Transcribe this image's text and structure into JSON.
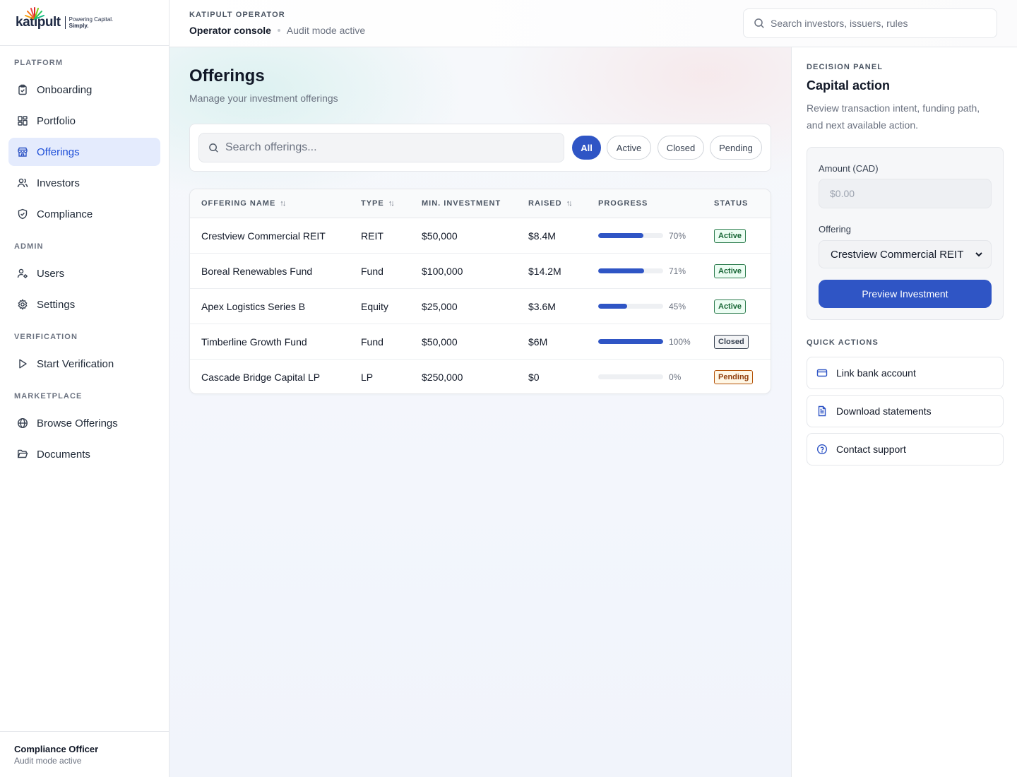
{
  "brand": {
    "logo_text": "katipult",
    "tagline_1": "Powering Capital.",
    "tagline_2": "Simply."
  },
  "sidebar": {
    "sections": [
      {
        "title": "PLATFORM",
        "items": [
          {
            "label": "Onboarding",
            "icon": "clipboard-check-icon"
          },
          {
            "label": "Portfolio",
            "icon": "layout-grid-icon"
          },
          {
            "label": "Offerings",
            "icon": "store-icon",
            "active": true
          },
          {
            "label": "Investors",
            "icon": "users-icon"
          },
          {
            "label": "Compliance",
            "icon": "shield-check-icon"
          }
        ]
      },
      {
        "title": "ADMIN",
        "items": [
          {
            "label": "Users",
            "icon": "user-cog-icon"
          },
          {
            "label": "Settings",
            "icon": "gear-icon"
          }
        ]
      },
      {
        "title": "VERIFICATION",
        "items": [
          {
            "label": "Start Verification",
            "icon": "play-icon"
          }
        ]
      },
      {
        "title": "MARKETPLACE",
        "items": [
          {
            "label": "Browse Offerings",
            "icon": "globe-icon"
          },
          {
            "label": "Documents",
            "icon": "folder-open-icon"
          }
        ]
      }
    ],
    "user": {
      "name": "Compliance Officer",
      "status": "Audit mode active"
    }
  },
  "topbar": {
    "kicker": "KATIPULT OPERATOR",
    "title": "Operator console",
    "subtitle": "Audit mode active",
    "search_placeholder": "Search investors, issuers, rules"
  },
  "main": {
    "title": "Offerings",
    "subtitle": "Manage your investment offerings",
    "search_placeholder": "Search offerings...",
    "filters": [
      "All",
      "Active",
      "Closed",
      "Pending"
    ],
    "active_filter": "All",
    "columns": [
      "OFFERING NAME",
      "TYPE",
      "MIN. INVESTMENT",
      "RAISED",
      "PROGRESS",
      "STATUS"
    ],
    "rows": [
      {
        "name": "Crestview Commercial REIT",
        "type": "REIT",
        "min": "$50,000",
        "raised": "$8.4M",
        "progress": 70,
        "progress_label": "70%",
        "status": "Active"
      },
      {
        "name": "Boreal Renewables Fund",
        "type": "Fund",
        "min": "$100,000",
        "raised": "$14.2M",
        "progress": 71,
        "progress_label": "71%",
        "status": "Active"
      },
      {
        "name": "Apex Logistics Series B",
        "type": "Equity",
        "min": "$25,000",
        "raised": "$3.6M",
        "progress": 45,
        "progress_label": "45%",
        "status": "Active"
      },
      {
        "name": "Timberline Growth Fund",
        "type": "Fund",
        "min": "$50,000",
        "raised": "$6M",
        "progress": 100,
        "progress_label": "100%",
        "status": "Closed"
      },
      {
        "name": "Cascade Bridge Capital LP",
        "type": "LP",
        "min": "$250,000",
        "raised": "$0",
        "progress": 0,
        "progress_label": "0%",
        "status": "Pending"
      }
    ]
  },
  "panel": {
    "kicker": "DECISION PANEL",
    "title": "Capital action",
    "description": "Review transaction intent, funding path, and next available action.",
    "amount_label": "Amount (CAD)",
    "amount_placeholder": "$0.00",
    "offering_label": "Offering",
    "offering_selected": "Crestview Commercial REIT",
    "preview_button": "Preview Investment",
    "quick_actions_title": "QUICK ACTIONS",
    "quick_actions": [
      {
        "label": "Link bank account",
        "icon": "credit-card-icon"
      },
      {
        "label": "Download statements",
        "icon": "file-text-icon"
      },
      {
        "label": "Contact support",
        "icon": "help-circle-icon"
      }
    ]
  },
  "colors": {
    "accent": "#2f55c5",
    "active_nav_bg": "#e4ebfd",
    "status_active": "#166534",
    "status_closed": "#374151",
    "status_pending": "#92400e"
  }
}
